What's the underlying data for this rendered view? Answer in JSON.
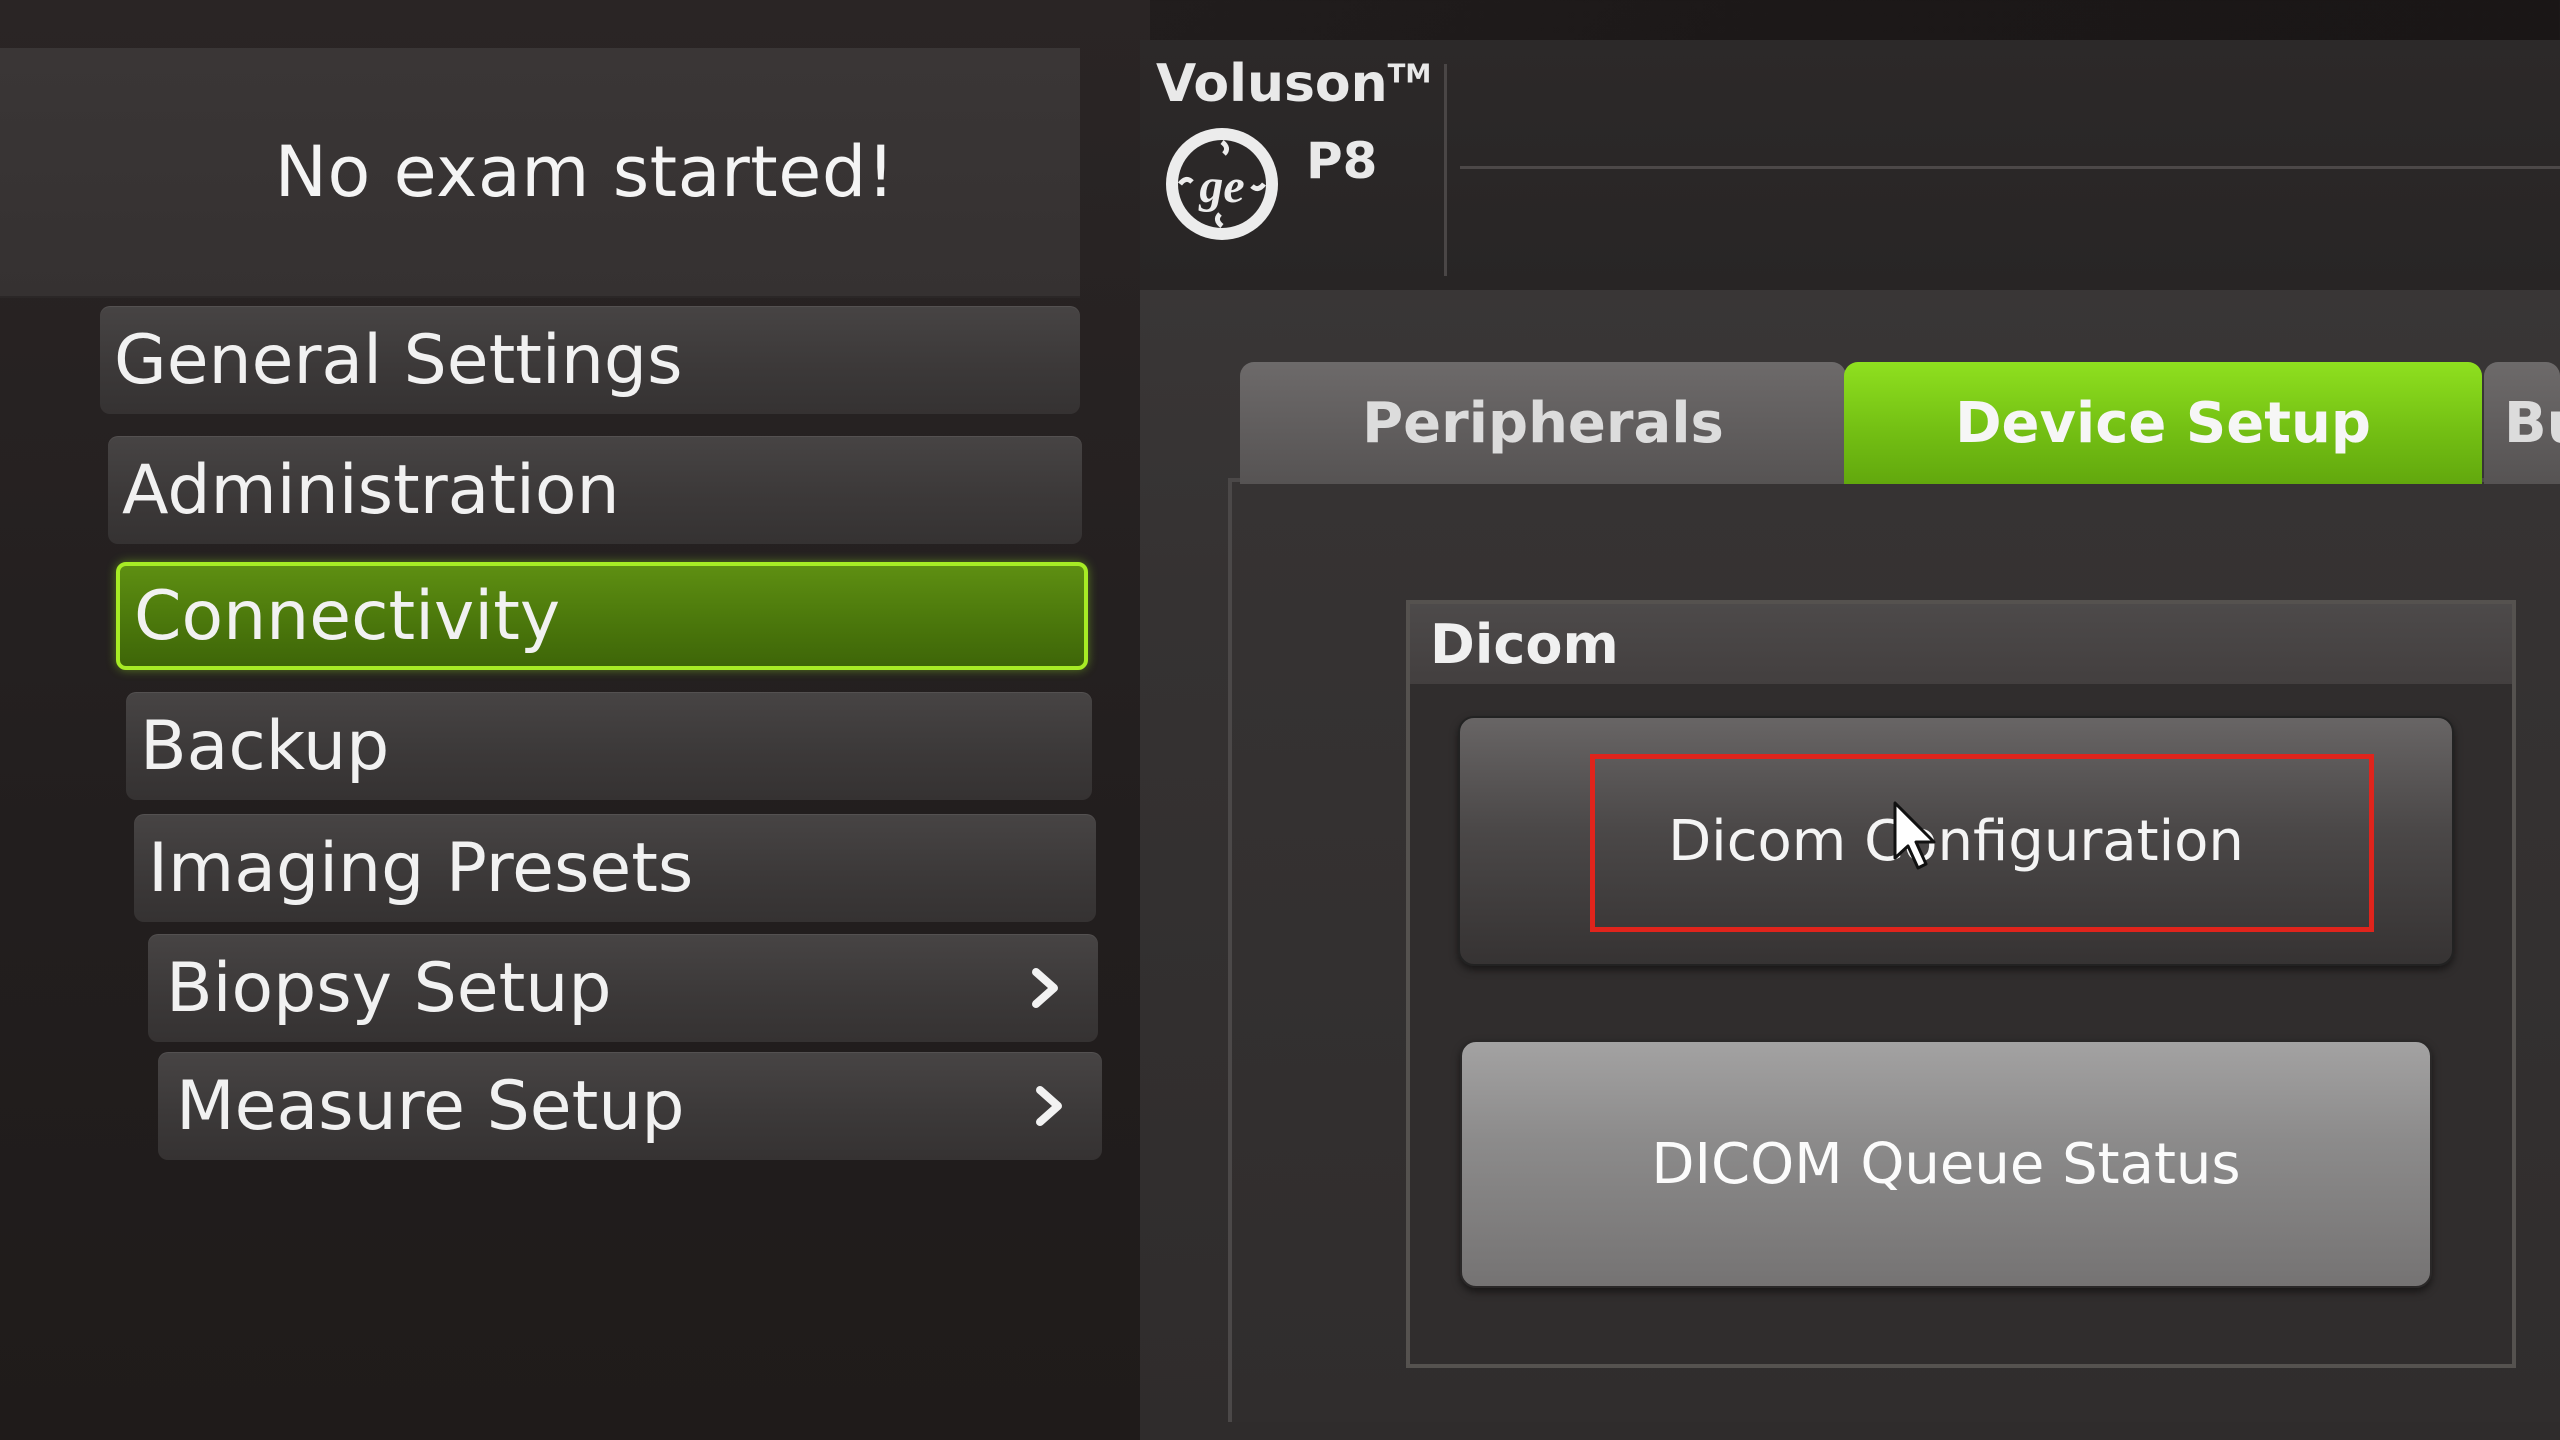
{
  "status": {
    "message": "No exam started!"
  },
  "brand": {
    "name": "Voluson",
    "trademark": "TM",
    "model": "P8",
    "logo": "ge-monogram-icon"
  },
  "menu": {
    "items": [
      {
        "label": "General Settings",
        "selected": false,
        "has_submenu": false
      },
      {
        "label": "Administration",
        "selected": false,
        "has_submenu": false
      },
      {
        "label": "Connectivity",
        "selected": true,
        "has_submenu": false
      },
      {
        "label": "Backup",
        "selected": false,
        "has_submenu": false
      },
      {
        "label": "Imaging Presets",
        "selected": false,
        "has_submenu": false
      },
      {
        "label": "Biopsy Setup",
        "selected": false,
        "has_submenu": true,
        "icon": "chevron-right-icon"
      },
      {
        "label": "Measure Setup",
        "selected": false,
        "has_submenu": true,
        "icon": "chevron-right-icon"
      }
    ]
  },
  "tabs": [
    {
      "label": "Peripherals",
      "active": false
    },
    {
      "label": "Device Setup",
      "active": true
    },
    {
      "label": "Bu",
      "active": false
    }
  ],
  "dicom_group": {
    "title": "Dicom",
    "buttons": {
      "configuration": "Dicom Configuration",
      "queue_status": "DICOM Queue Status"
    }
  },
  "colors": {
    "accent_green": "#74c014",
    "selected_border": "#a7ec25",
    "highlight_red": "#e0241c"
  }
}
